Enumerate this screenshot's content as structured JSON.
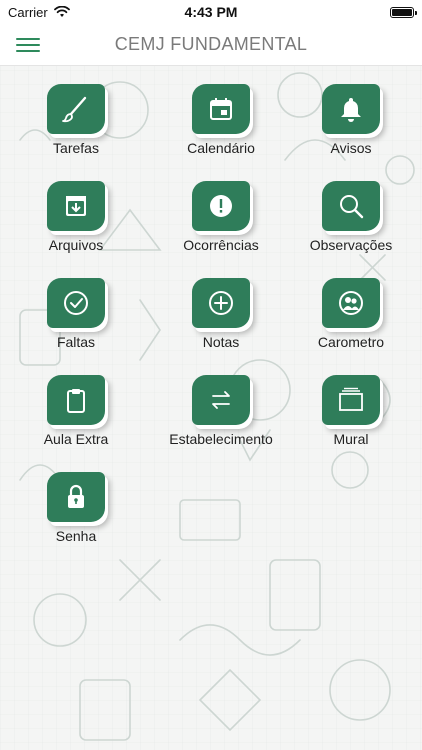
{
  "status_bar": {
    "carrier": "Carrier",
    "time": "4:43 PM"
  },
  "nav": {
    "title": "CEMJ FUNDAMENTAL"
  },
  "colors": {
    "accent": "#2f7d5a",
    "menu_icon": "#2e8a5c"
  },
  "menu": [
    {
      "label": "Tarefas",
      "icon": "paintbrush-icon"
    },
    {
      "label": "Calendário",
      "icon": "calendar-icon"
    },
    {
      "label": "Avisos",
      "icon": "bell-icon"
    },
    {
      "label": "Arquivos",
      "icon": "archive-icon"
    },
    {
      "label": "Ocorrências",
      "icon": "alert-icon"
    },
    {
      "label": "Observações",
      "icon": "search-icon"
    },
    {
      "label": "Faltas",
      "icon": "check-circle-icon"
    },
    {
      "label": "Notas",
      "icon": "plus-circle-icon"
    },
    {
      "label": "Carometro",
      "icon": "people-icon"
    },
    {
      "label": "Aula Extra",
      "icon": "clipboard-icon"
    },
    {
      "label": "Estabelecimento",
      "icon": "swap-arrows-icon"
    },
    {
      "label": "Mural",
      "icon": "stacked-cards-icon"
    },
    {
      "label": "Senha",
      "icon": "lock-icon"
    }
  ]
}
